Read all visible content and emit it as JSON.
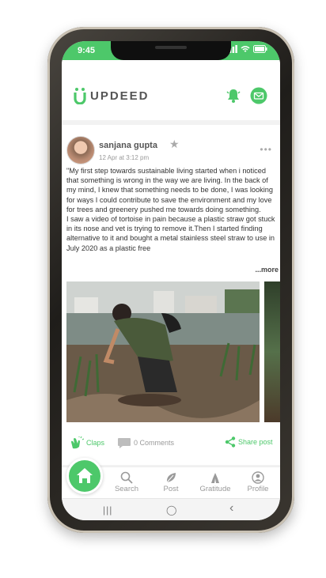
{
  "status": {
    "time": "9:45"
  },
  "brand": {
    "name": "UPDEED",
    "accent": "#4dc86a"
  },
  "header": {
    "notification_icon": "bell-icon",
    "message_icon": "mail-icon"
  },
  "post": {
    "author": "sanjana  gupta",
    "date": "12 Apr at 3:12 pm",
    "text_lines": [
      "\"My first step towards sustainable living started when i noticed that something is wrong in the way we are living. In the back of my mind, I knew that something needs to be done, I was looking for ways I could contribute to save the environment and my love for trees and greenery pushed me towards doing something.",
      " I saw a video of tortoise in pain because a plastic straw got stuck in its nose and vet is trying to remove it.Then I started finding alternative to it and bought a metal stainless steel straw to use in July 2020 as a plastic free"
    ],
    "more_label": "...more",
    "claps_label": "Claps",
    "comments_label": "0 Comments",
    "share_label": "Share post"
  },
  "tabs": [
    {
      "label": "Search",
      "icon": "search-icon"
    },
    {
      "label": "Post",
      "icon": "leaf-icon"
    },
    {
      "label": "Gratitude",
      "icon": "gratitude-icon"
    },
    {
      "label": "Profile",
      "icon": "profile-icon"
    }
  ],
  "navbar": {
    "recent": "|||",
    "home": "◯",
    "back": "‹"
  }
}
